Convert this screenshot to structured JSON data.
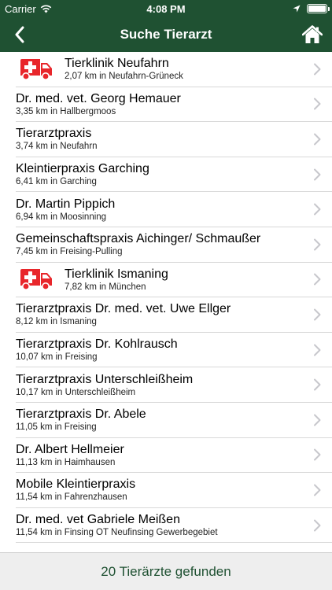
{
  "status_bar": {
    "carrier": "Carrier",
    "time": "4:08 PM",
    "battery_level": 1.0
  },
  "nav": {
    "title": "Suche Tierarzt",
    "back_icon": "chevron-left-icon",
    "home_icon": "home-icon"
  },
  "colors": {
    "brand_green": "#1f5132",
    "ambulance_red": "#e8262b",
    "chevron": "#c7c7cc"
  },
  "items": [
    {
      "name": "Tierklinik Neufahrn",
      "detail": "2,07 km in Neufahrn-Grüneck",
      "clinic": true
    },
    {
      "name": "Dr. med. vet. Georg Hemauer",
      "detail": "3,35 km in Hallbergmoos",
      "clinic": false
    },
    {
      "name": "Tierarztpraxis",
      "detail": "3,74 km in Neufahrn",
      "clinic": false
    },
    {
      "name": "Kleintierpraxis Garching",
      "detail": "6,41 km in Garching",
      "clinic": false
    },
    {
      "name": "Dr. Martin Pippich",
      "detail": "6,94 km in Moosinning",
      "clinic": false
    },
    {
      "name": "Gemeinschaftspraxis Aichinger/ Schmaußer",
      "detail": "7,45 km in Freising-Pulling",
      "clinic": false
    },
    {
      "name": "Tierklinik Ismaning",
      "detail": "7,82 km in München",
      "clinic": true
    },
    {
      "name": "Tierarztpraxis Dr. med. vet. Uwe Ellger",
      "detail": "8,12 km in Ismaning",
      "clinic": false
    },
    {
      "name": "Tierarztpraxis Dr. Kohlrausch",
      "detail": "10,07 km in Freising",
      "clinic": false
    },
    {
      "name": "Tierarztpraxis Unterschleißheim",
      "detail": "10,17 km in Unterschleißheim",
      "clinic": false
    },
    {
      "name": "Tierarztpraxis Dr. Abele",
      "detail": "11,05 km in Freising",
      "clinic": false
    },
    {
      "name": "Dr. Albert Hellmeier",
      "detail": "11,13 km in Haimhausen",
      "clinic": false
    },
    {
      "name": "Mobile Kleintierpraxis",
      "detail": "11,54 km in Fahrenzhausen",
      "clinic": false
    },
    {
      "name": "Dr. med. vet Gabriele Meißen",
      "detail": "11,54 km in Finsing OT Neufinsing Gewerbegebiet",
      "clinic": false
    }
  ],
  "footer": {
    "result_text": "20 Tierärzte gefunden"
  }
}
